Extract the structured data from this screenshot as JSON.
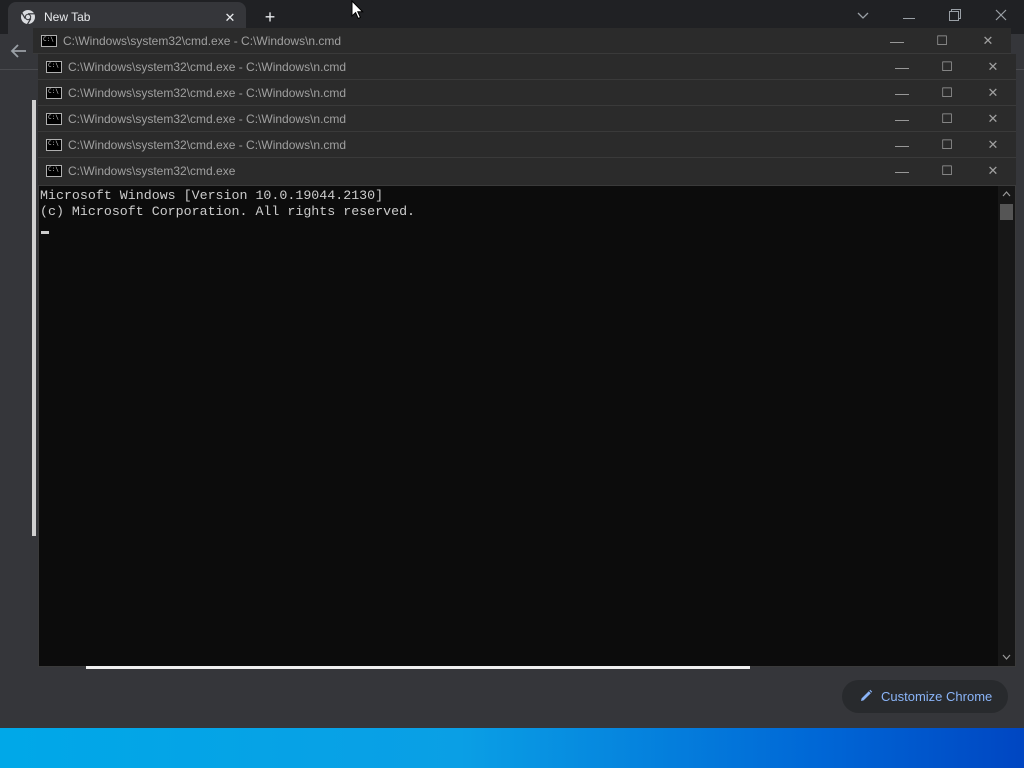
{
  "chrome": {
    "tab_title": "New Tab",
    "tab_close": "✕",
    "new_tab": "+",
    "customize_label": "Customize Chrome"
  },
  "cmd_windows": [
    {
      "title": "C:\\Windows\\system32\\cmd.exe - C:\\Windows\\n.cmd"
    },
    {
      "title": "C:\\Windows\\system32\\cmd.exe - C:\\Windows\\n.cmd"
    },
    {
      "title": "C:\\Windows\\system32\\cmd.exe - C:\\Windows\\n.cmd"
    },
    {
      "title": "C:\\Windows\\system32\\cmd.exe - C:\\Windows\\n.cmd"
    },
    {
      "title": "C:\\Windows\\system32\\cmd.exe - C:\\Windows\\n.cmd"
    },
    {
      "title": "C:\\Windows\\system32\\cmd.exe"
    }
  ],
  "console": {
    "line1": "Microsoft Windows [Version 10.0.19044.2130]",
    "line2": "(c) Microsoft Corporation. All rights reserved."
  },
  "window_buttons": {
    "minimize": "—",
    "maximize": "☐",
    "close": "✕"
  },
  "icons": {
    "chrome_logo": "chrome-logo-icon",
    "back": "back-arrow-icon",
    "pencil": "pencil-icon",
    "cmd": "cmd-icon"
  },
  "colors": {
    "chrome_bg": "#35363a",
    "console_bg": "#0c0c0c",
    "console_text": "#cccccc",
    "accent_link": "#8ab4f8"
  }
}
